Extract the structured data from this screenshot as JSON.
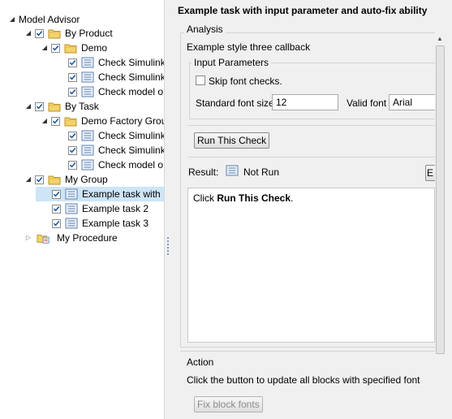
{
  "tree": {
    "root": "Model Advisor",
    "items": [
      {
        "label": "By Product"
      },
      {
        "label": "Demo"
      },
      {
        "label": "Check Simulink"
      },
      {
        "label": "Check Simulink"
      },
      {
        "label": "Check model o"
      },
      {
        "label": "By Task"
      },
      {
        "label": "Demo Factory Grou"
      },
      {
        "label": "Check Simulink"
      },
      {
        "label": "Check Simulink"
      },
      {
        "label": "Check model o"
      },
      {
        "label": "My Group"
      },
      {
        "label": "Example task with"
      },
      {
        "label": "Example task 2"
      },
      {
        "label": "Example task 3"
      },
      {
        "label": "My Procedure"
      }
    ]
  },
  "panel": {
    "title": "Example task with input parameter and auto-fix ability",
    "analysis_label": "Analysis",
    "analysis_desc": "Example style three callback",
    "input_params_label": "Input Parameters",
    "skip_font_label": "Skip font checks.",
    "std_font_size_label": "Standard font size",
    "std_font_size_value": "12",
    "valid_font_label": "Valid font",
    "valid_font_value": "Arial",
    "run_check_label": "Run This Check",
    "result_label": "Result:",
    "result_status": "Not Run",
    "ex_button_label": "E",
    "result_text_pre": "Click ",
    "result_text_bold": "Run This Check",
    "result_text_post": ".",
    "action_label": "Action",
    "action_desc": "Click the button to update all blocks with specified font",
    "fix_button_label": "Fix block fonts"
  },
  "colors": {
    "folder": "#e8c24a",
    "check": "#0a4f9e",
    "selection": "#cde5f7"
  }
}
